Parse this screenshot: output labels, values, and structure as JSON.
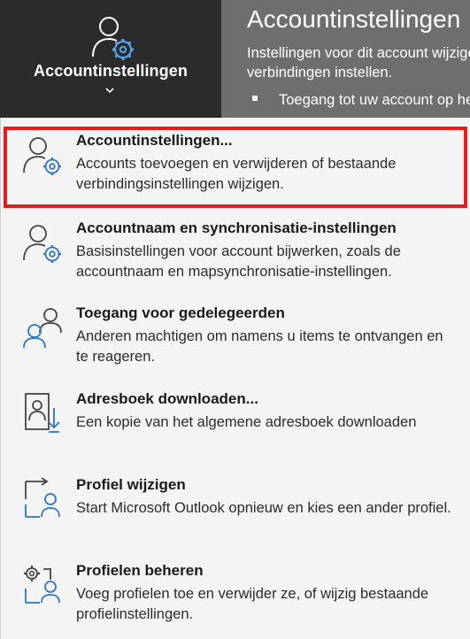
{
  "header": {
    "button_label": "Accountinstellingen",
    "panel_title": "Accountinstellingen",
    "panel_desc_line1": "Instellingen voor dit account wijzigen of meer",
    "panel_desc_line2": "verbindingen instellen.",
    "panel_bullet": "Toegang tot uw account op het web"
  },
  "menu": {
    "items": [
      {
        "title": "Accountinstellingen...",
        "desc": "Accounts toevoegen en verwijderen of bestaande verbindingsinstellingen wijzigen.",
        "icon": "person-gear-icon"
      },
      {
        "title": "Accountnaam en synchronisatie-instellingen",
        "desc": "Basisinstellingen voor account bijwerken, zoals de accountnaam en mapsynchronisatie-instellingen.",
        "icon": "person-gear-icon"
      },
      {
        "title": "Toegang voor gedelegeerden",
        "desc": "Anderen machtigen om namens u items te ontvangen en te reageren.",
        "icon": "delegate-people-icon"
      },
      {
        "title": "Adresboek downloaden...",
        "desc": "Een kopie van het algemene adresboek downloaden",
        "icon": "address-book-download-icon"
      },
      {
        "title": "Profiel wijzigen",
        "desc": "Start  Microsoft Outlook opnieuw en kies een ander profiel.",
        "icon": "switch-profile-icon"
      },
      {
        "title": "Profielen beheren",
        "desc": "Voeg profielen toe en verwijder ze, of wijzig bestaande profielinstellingen.",
        "icon": "manage-profiles-icon"
      }
    ]
  },
  "colors": {
    "highlight": "#e41e1e",
    "accent_blue": "#2e75c7",
    "dark_button": "#2b2b2b"
  }
}
